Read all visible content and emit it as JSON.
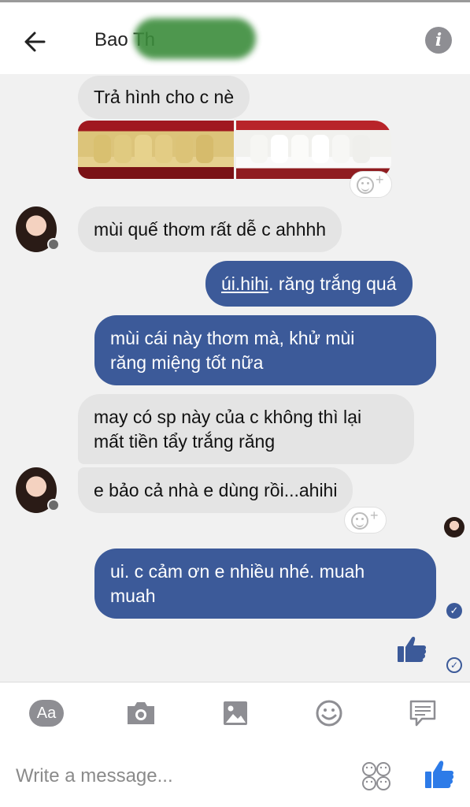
{
  "header": {
    "title": "Bao Th",
    "back_icon": "arrow-left-icon",
    "info_icon": "info-icon",
    "info_glyph": "i"
  },
  "messages": [
    {
      "id": "m1",
      "from": "them",
      "text": "Trả hình cho c nè"
    },
    {
      "id": "m2",
      "from": "them",
      "type": "image",
      "description_icon": "teeth-photo"
    },
    {
      "id": "m3",
      "from": "them",
      "text": "mùi quế thơm rất dễ c ahhhh"
    },
    {
      "id": "m4",
      "from": "me",
      "text_link": "úi.hihi",
      "text_rest": ". răng trắng quá"
    },
    {
      "id": "m5",
      "from": "me",
      "line1": "mùi cái này thơm mà, khử mùi",
      "line2": "răng miệng tốt nữa"
    },
    {
      "id": "m6",
      "from": "them",
      "line1": "may có sp này của c không thì lại",
      "line2": "mất tiền tẩy trắng răng"
    },
    {
      "id": "m7",
      "from": "them",
      "text": "e bảo cả nhà e dùng rồi...ahihi"
    },
    {
      "id": "m8",
      "from": "me",
      "line1": "ui. c cảm ơn e nhiều nhé. muah",
      "line2": "muah"
    }
  ],
  "reaction": {
    "plus": "+"
  },
  "toolbar": {
    "aa_label": "Aa",
    "icons": [
      "camera-icon",
      "gallery-icon",
      "emoji-icon",
      "sticker-message-icon"
    ]
  },
  "composer": {
    "placeholder": "Write a message...",
    "icons": [
      "emoji-set-icon",
      "like-icon"
    ]
  },
  "colors": {
    "outgoing": "#3c5a99",
    "incoming": "#e4e4e4",
    "background": "#f1f1f1"
  }
}
